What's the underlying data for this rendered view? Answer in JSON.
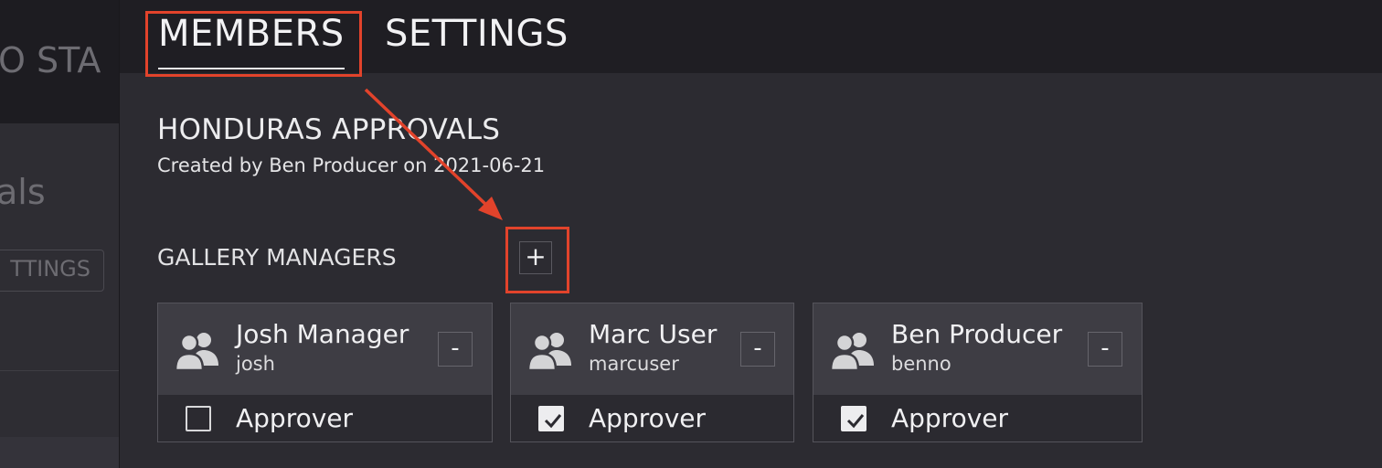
{
  "background_app": {
    "title_fragment": "O STA",
    "heading_fragment": "als",
    "tab_fragment": "TTINGS"
  },
  "tabs": {
    "members": "MEMBERS",
    "settings": "SETTINGS"
  },
  "group": {
    "title": "HONDURAS APPROVALS",
    "subtitle": "Created by Ben Producer on 2021-06-21"
  },
  "section": {
    "label": "GALLERY MANAGERS",
    "add_button": "+"
  },
  "members": [
    {
      "name": "Josh Manager",
      "username": "josh",
      "remove_label": "-",
      "role": "Approver",
      "approver": false
    },
    {
      "name": "Marc User",
      "username": "marcuser",
      "remove_label": "-",
      "role": "Approver",
      "approver": true
    },
    {
      "name": "Ben Producer",
      "username": "benno",
      "remove_label": "-",
      "role": "Approver",
      "approver": true
    }
  ],
  "colors": {
    "panel_bg": "#2c2b31",
    "topbar_bg": "#1f1e23",
    "card_header_bg": "#3e3d44",
    "annotation_red": "#e2432b"
  },
  "icons": {
    "member": "users-icon",
    "checked": "checkbox-checked-icon",
    "unchecked": "checkbox-unchecked-icon"
  }
}
